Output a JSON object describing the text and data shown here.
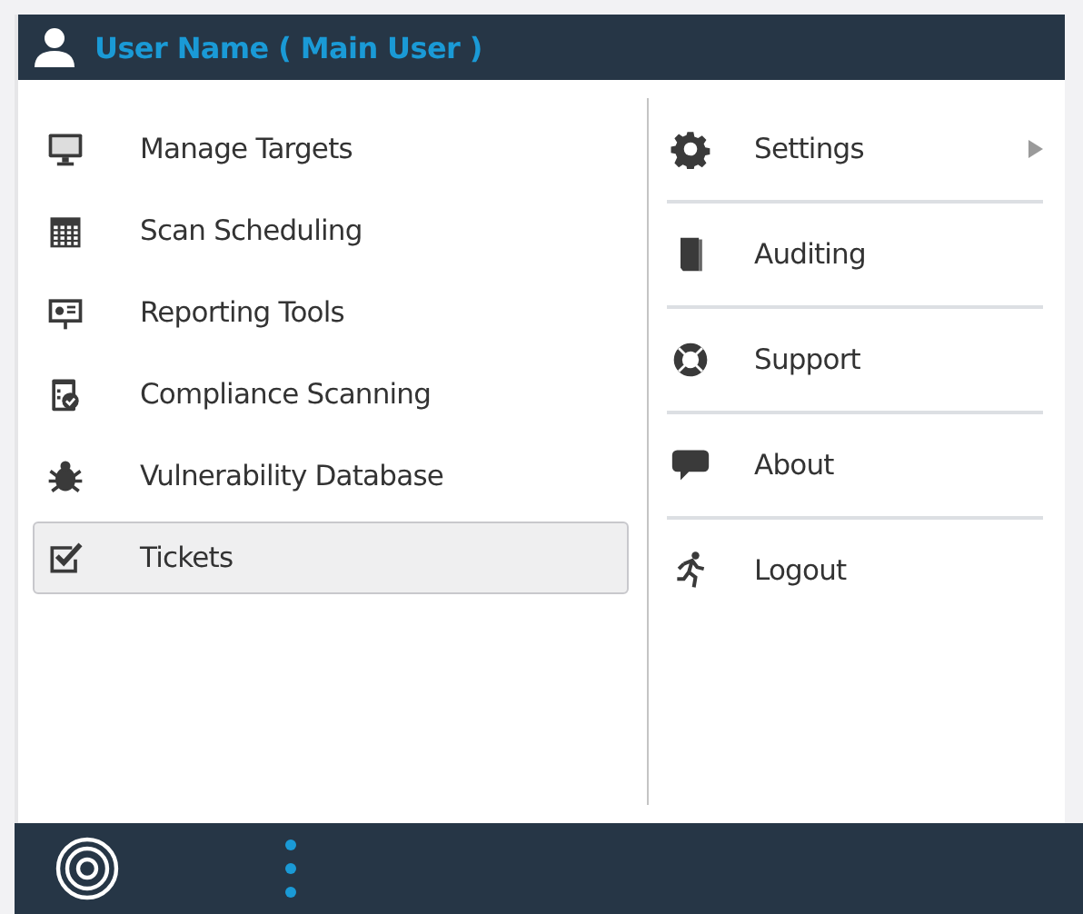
{
  "header": {
    "user": "User Name ( Main User )"
  },
  "menu": [
    {
      "label": "Manage Targets",
      "selected": false
    },
    {
      "label": "Scan Scheduling",
      "selected": false
    },
    {
      "label": "Reporting Tools",
      "selected": false
    },
    {
      "label": "Compliance Scanning",
      "selected": false
    },
    {
      "label": "Vulnerability Database",
      "selected": false
    },
    {
      "label": "Tickets",
      "selected": true
    }
  ],
  "account_menu": [
    {
      "label": "Settings",
      "submenu": true
    },
    {
      "label": "Auditing",
      "submenu": false
    },
    {
      "label": "Support",
      "submenu": false
    },
    {
      "label": "About",
      "submenu": false
    },
    {
      "label": "Logout",
      "submenu": false
    }
  ]
}
